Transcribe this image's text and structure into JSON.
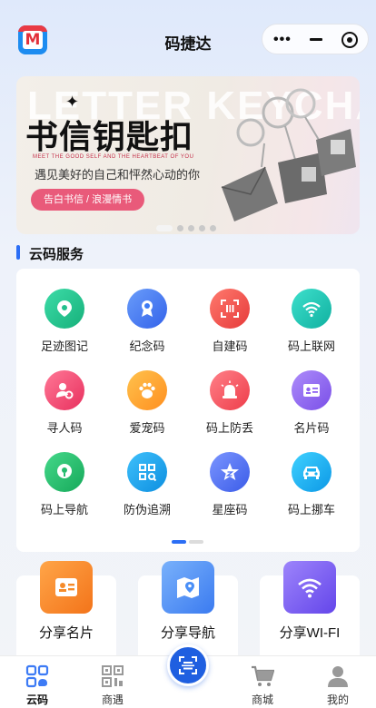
{
  "header": {
    "title": "码捷达",
    "logo_letter": "M",
    "capsule": {
      "more_icon": "more-icon",
      "minimize_icon": "minimize-icon",
      "close_icon": "target-icon"
    }
  },
  "banner": {
    "bg_text": "LETTER KEYCHAIN",
    "headline": "书信钥匙扣",
    "small_en": "MEET THE GOOD SELF AND THE HEARTBEAT OF YOU",
    "subline": "遇见美好的自己和怦然心动的你",
    "pill": "告白书信 / 浪漫情书",
    "dots_count": 5,
    "active_dot": 0
  },
  "section": {
    "title": "云码服务"
  },
  "services": [
    {
      "label": "足迹图记",
      "icon": "footprint-map-icon",
      "color": "#22c08c"
    },
    {
      "label": "纪念码",
      "icon": "ribbon-badge-icon",
      "color": "#3d7bf5"
    },
    {
      "label": "自建码",
      "icon": "qr-frame-icon",
      "color": "#f0514a"
    },
    {
      "label": "码上联网",
      "icon": "wifi-icon",
      "color": "#16c7b6"
    },
    {
      "label": "寻人码",
      "icon": "person-icon",
      "color": "#f2496f"
    },
    {
      "label": "爱宠码",
      "icon": "paw-icon",
      "color": "#ffa62b"
    },
    {
      "label": "码上防丢",
      "icon": "siren-icon",
      "color": "#f6565e"
    },
    {
      "label": "名片码",
      "icon": "contact-card-icon",
      "color": "#8f63f2"
    },
    {
      "label": "码上导航",
      "icon": "location-pin-icon",
      "color": "#25bb6e"
    },
    {
      "label": "防伪追溯",
      "icon": "scan-qr-icon",
      "color": "#1aa6f0"
    },
    {
      "label": "星座码",
      "icon": "star-icon",
      "color": "#4a6ef5"
    },
    {
      "label": "码上挪车",
      "icon": "car-icon",
      "color": "#1ab0f2"
    }
  ],
  "share": [
    {
      "label": "分享名片",
      "icon": "card-icon",
      "color": "#f58b2a"
    },
    {
      "label": "分享导航",
      "icon": "map-icon",
      "color": "#4a8ff7"
    },
    {
      "label": "分享WI-FI",
      "icon": "wifi-icon",
      "color": "#7a5cf3"
    }
  ],
  "tabbar": {
    "tabs": [
      {
        "label": "云码",
        "icon": "grid-qr-icon",
        "active": true
      },
      {
        "label": "商遇",
        "icon": "qr-code-icon",
        "active": false
      },
      {
        "label": "商城",
        "icon": "cart-icon",
        "active": false
      },
      {
        "label": "我的",
        "icon": "user-icon",
        "active": false
      }
    ],
    "scan_icon": "scan-icon"
  }
}
